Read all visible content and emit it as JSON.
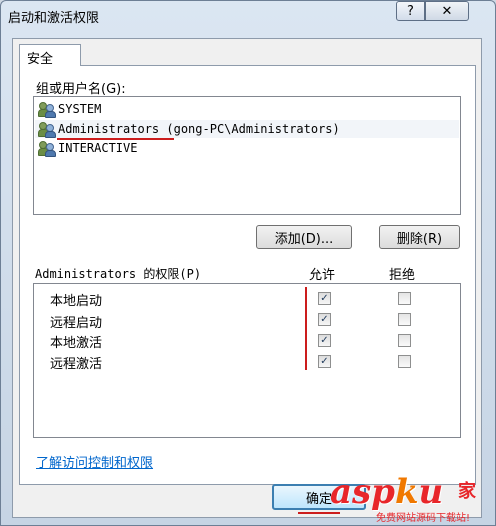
{
  "window": {
    "title": "启动和激活权限",
    "help_label": "?",
    "close_label": "✕"
  },
  "tab": {
    "label": "安全"
  },
  "groups": {
    "label": "组或用户名(G):",
    "items": [
      {
        "name": "SYSTEM",
        "selected": false
      },
      {
        "name": "Administrators (gong-PC\\Administrators)",
        "selected": true
      },
      {
        "name": "INTERACTIVE",
        "selected": false
      }
    ]
  },
  "buttons": {
    "add": "添加(D)...",
    "remove": "删除(R)",
    "ok": "确定"
  },
  "permissions": {
    "header": "Administrators 的权限(P)",
    "allow_header": "允许",
    "deny_header": "拒绝",
    "rows": [
      {
        "name": "本地启动",
        "allow": true,
        "deny": false
      },
      {
        "name": "远程启动",
        "allow": true,
        "deny": false
      },
      {
        "name": "本地激活",
        "allow": true,
        "deny": false
      },
      {
        "name": "远程激活",
        "allow": true,
        "deny": false
      }
    ]
  },
  "link": {
    "label": "了解访问控制和权限"
  },
  "watermark": {
    "text": "asp",
    "dot": "k",
    "suffix": "u",
    "cn": "家",
    "sub": "免费网站源码下载站!"
  },
  "colors": {
    "annotation_red": "#cc1d1d",
    "link_blue": "#0066cc",
    "ok_border": "#3c7fb1"
  },
  "icons": {
    "user": "users-group-icon",
    "check": "✓"
  }
}
